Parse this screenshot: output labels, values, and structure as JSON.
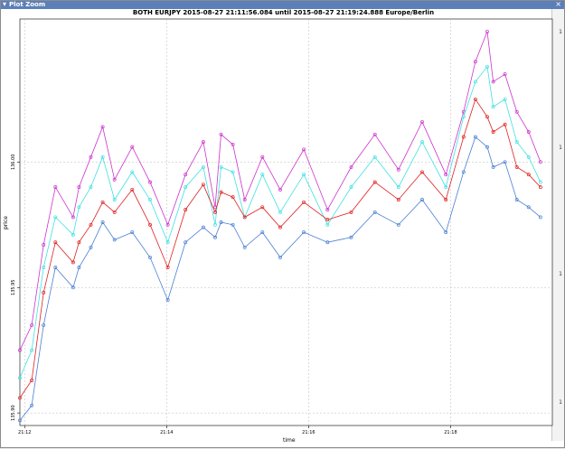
{
  "window": {
    "title": "Plot Zoom",
    "menu_icon": "menu-arrow-icon",
    "close_icon": "close-icon"
  },
  "chart_data": {
    "type": "line",
    "title": "BOTH EURJPY  2015-08-27 21:11:56.084 until 2015-08-27 21:19:24.888 Europe/Berlin",
    "xlabel": "time",
    "ylabel": "price",
    "xlim": [
      0,
      450
    ],
    "ylim": [
      135.895,
      136.057
    ],
    "x_unit": "seconds since 21:11:56",
    "x_ticks": [
      {
        "value": 4,
        "label": "21:12"
      },
      {
        "value": 124,
        "label": "21:14"
      },
      {
        "value": 244,
        "label": "21:16"
      },
      {
        "value": 364,
        "label": "21:18"
      }
    ],
    "y_ticks": [
      {
        "value": 135.9,
        "label": "135.90"
      },
      {
        "value": 135.95,
        "label": "135.95"
      },
      {
        "value": 136.0,
        "label": "136.00"
      }
    ],
    "grid": true,
    "right_edge_labels": [
      "1",
      "1",
      "1",
      "1"
    ],
    "colors": {
      "bid": "#4a7fd4",
      "ask": "#cc33cc",
      "mid_upper": "#40e0e0",
      "mid": "#e02020"
    },
    "series": [
      {
        "name": "",
        "color": "#cc33cc",
        "x": [
          0,
          10,
          20,
          30,
          45,
          50,
          60,
          70,
          80,
          95,
          110,
          125,
          140,
          155,
          165,
          170,
          180,
          190,
          205,
          220,
          240,
          260,
          280,
          300,
          320,
          340,
          360,
          375,
          385,
          395,
          400,
          410,
          420,
          430,
          440
        ],
        "y": [
          135.925,
          135.935,
          135.967,
          135.99,
          135.978,
          135.99,
          136.002,
          136.014,
          135.993,
          136.006,
          135.992,
          135.975,
          135.995,
          136.008,
          135.982,
          136.011,
          136.007,
          135.985,
          136.002,
          135.989,
          136.005,
          135.981,
          135.998,
          136.011,
          135.997,
          136.016,
          135.995,
          136.02,
          136.04,
          136.052,
          136.032,
          136.035,
          136.02,
          136.012,
          136.0
        ]
      },
      {
        "name": "",
        "color": "#40e0e0",
        "x": [
          0,
          10,
          20,
          30,
          45,
          50,
          60,
          70,
          80,
          95,
          110,
          125,
          140,
          155,
          165,
          170,
          180,
          190,
          205,
          220,
          240,
          260,
          280,
          300,
          320,
          340,
          360,
          375,
          385,
          395,
          400,
          410,
          420,
          430,
          440
        ],
        "y": [
          135.914,
          135.925,
          135.958,
          135.978,
          135.971,
          135.982,
          135.99,
          136.002,
          135.985,
          135.996,
          135.985,
          135.968,
          135.99,
          135.998,
          135.975,
          135.998,
          135.996,
          135.978,
          135.995,
          135.98,
          135.995,
          135.975,
          135.99,
          136.002,
          135.99,
          136.008,
          135.99,
          136.018,
          136.032,
          136.038,
          136.022,
          136.025,
          136.008,
          136.002,
          135.992
        ]
      },
      {
        "name": "",
        "color": "#e02020",
        "x": [
          0,
          10,
          20,
          30,
          45,
          50,
          60,
          70,
          80,
          95,
          110,
          125,
          140,
          155,
          165,
          170,
          180,
          190,
          205,
          220,
          240,
          260,
          280,
          300,
          320,
          340,
          360,
          375,
          385,
          395,
          400,
          410,
          420,
          430,
          440
        ],
        "y": [
          135.906,
          135.913,
          135.948,
          135.968,
          135.96,
          135.968,
          135.975,
          135.984,
          135.98,
          135.989,
          135.975,
          135.958,
          135.981,
          135.991,
          135.98,
          135.988,
          135.986,
          135.978,
          135.982,
          135.974,
          135.984,
          135.977,
          135.98,
          135.992,
          135.985,
          135.996,
          135.985,
          136.01,
          136.025,
          136.018,
          136.012,
          136.015,
          135.998,
          135.995,
          135.99
        ]
      },
      {
        "name": "",
        "color": "#4a7fd4",
        "x": [
          0,
          10,
          20,
          30,
          45,
          50,
          60,
          70,
          80,
          95,
          110,
          125,
          140,
          155,
          165,
          170,
          180,
          190,
          205,
          220,
          240,
          260,
          280,
          300,
          320,
          340,
          360,
          375,
          385,
          395,
          400,
          410,
          420,
          430,
          440
        ],
        "y": [
          135.897,
          135.903,
          135.935,
          135.958,
          135.95,
          135.958,
          135.966,
          135.976,
          135.969,
          135.972,
          135.962,
          135.945,
          135.968,
          135.974,
          135.97,
          135.976,
          135.975,
          135.966,
          135.972,
          135.962,
          135.972,
          135.968,
          135.97,
          135.98,
          135.975,
          135.985,
          135.972,
          135.996,
          136.01,
          136.006,
          135.998,
          136.0,
          135.985,
          135.982,
          135.978
        ]
      }
    ]
  }
}
